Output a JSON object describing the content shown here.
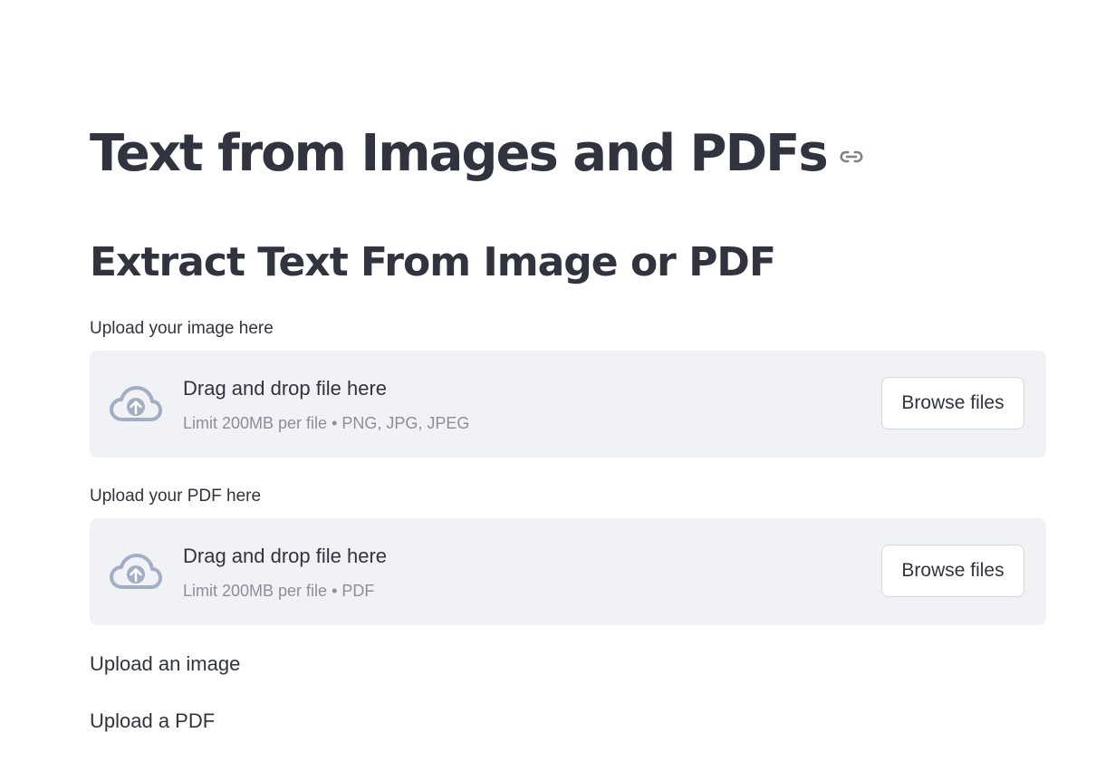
{
  "page": {
    "title": "Text from Images and PDFs",
    "subtitle": "Extract Text From Image or PDF"
  },
  "uploaders": [
    {
      "label": "Upload your image here",
      "drop_text": "Drag and drop file here",
      "limit_text": "Limit 200MB per file • PNG, JPG, JPEG",
      "button_label": "Browse files"
    },
    {
      "label": "Upload your PDF here",
      "drop_text": "Drag and drop file here",
      "limit_text": "Limit 200MB per file • PDF",
      "button_label": "Browse files"
    }
  ],
  "messages": [
    "Upload an image",
    "Upload a PDF"
  ],
  "icons": {
    "title_anchor": "link-icon",
    "upload": "cloud-upload-icon"
  },
  "colors": {
    "text": "#31333f",
    "muted_text": "#8c8f98",
    "dropzone_bg": "#f0f2f6",
    "icon": "#a3aec5",
    "button_border": "#d5d7dd"
  }
}
